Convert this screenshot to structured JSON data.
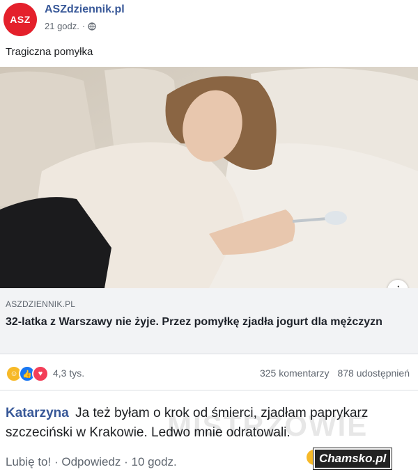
{
  "post": {
    "page_name": "ASZdziennik.pl",
    "avatar_text": "ASZ",
    "time": "21 godz.",
    "separator": "·",
    "caption": "Tragiczna pomyłka"
  },
  "link": {
    "domain": "ASZDZIENNIK.PL",
    "headline": "32-latka z Warszawy nie żyje. Przez pomyłkę zjadła jogurt dla mężczyzn",
    "info_icon": "i"
  },
  "reactions": {
    "count": "4,3 tys.",
    "comments": "325 komentarzy",
    "shares": "878 udostępnień",
    "icons": [
      "haha-icon",
      "like-icon",
      "love-icon"
    ]
  },
  "comment": {
    "author": "Katarzyna",
    "text": "Ja też byłam o krok od śmierci, zjadłam paprykarz szczeciński w Krakowie. Ledwo mnie odratowali.",
    "like": "Lubię to!",
    "reply": "Odpowiedz",
    "time": "10 godz.",
    "sep": " · "
  },
  "watermarks": {
    "mistrz": "MISTRZOWIE",
    "badge": "Chamsko.pl"
  },
  "colors": {
    "brand_red": "#e4202b",
    "link_blue": "#385898",
    "meta_gray": "#606770"
  }
}
